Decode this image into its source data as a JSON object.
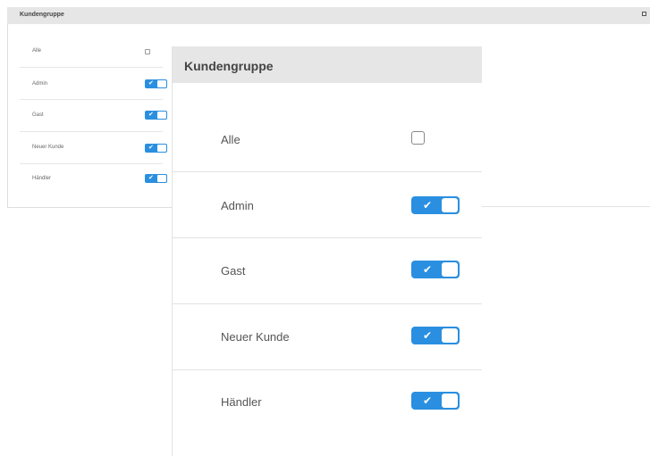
{
  "small_panel": {
    "title": "Kundengruppe",
    "rows": [
      {
        "label": "Alle",
        "control": "checkbox",
        "checked": false
      },
      {
        "label": "Admin",
        "control": "toggle",
        "checked": true
      },
      {
        "label": "Gast",
        "control": "toggle",
        "checked": true
      },
      {
        "label": "Neuer Kunde",
        "control": "toggle",
        "checked": true
      },
      {
        "label": "Händler",
        "control": "toggle",
        "checked": true
      }
    ]
  },
  "large_panel": {
    "title": "Kundengruppe",
    "rows": [
      {
        "label": "Alle",
        "control": "checkbox",
        "checked": false
      },
      {
        "label": "Admin",
        "control": "toggle",
        "checked": true
      },
      {
        "label": "Gast",
        "control": "toggle",
        "checked": true
      },
      {
        "label": "Neuer Kunde",
        "control": "toggle",
        "checked": true
      },
      {
        "label": "Händler",
        "control": "toggle",
        "checked": true
      }
    ]
  },
  "icons": {
    "toggle_on": "check-icon",
    "maximize": "maximize-icon"
  },
  "colors": {
    "accent": "#2a8fe0",
    "header_bg": "#e6e6e6"
  }
}
